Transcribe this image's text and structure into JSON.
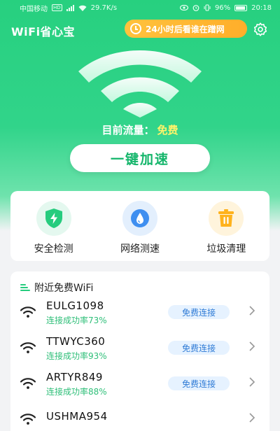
{
  "status_bar": {
    "carrier": "中国移动",
    "network_type": "HD",
    "speed": "29.7K/s",
    "battery": "96%",
    "time": "20:18"
  },
  "header": {
    "app_title": "WiFi省心宝",
    "promo_label": "24小时后看谁在蹭网"
  },
  "hero": {
    "traffic_label": "目前流量：",
    "traffic_value": "免费",
    "speed_button": "一键加速"
  },
  "tools": [
    {
      "label": "安全检测",
      "icon": "shield-bolt-icon",
      "bg": "#e4f8ef",
      "color": "#26cc7e"
    },
    {
      "label": "网络测速",
      "icon": "speed-drop-icon",
      "bg": "#e3effd",
      "color": "#3f8ff0"
    },
    {
      "label": "垃圾清理",
      "icon": "trash-icon",
      "bg": "#fff4dc",
      "color": "#ffb21c"
    }
  ],
  "nearby": {
    "title": "附近免费WiFi",
    "items": [
      {
        "ssid": "EULG1098",
        "rate": "连接成功率73%",
        "action": "免费连接"
      },
      {
        "ssid": "TTWYC360",
        "rate": "连接成功率93%",
        "action": "免费连接"
      },
      {
        "ssid": "ARTYR849",
        "rate": "连接成功率88%",
        "action": "免费连接"
      },
      {
        "ssid": "USHMA954",
        "rate": "",
        "action": ""
      }
    ]
  },
  "colors": {
    "brand_green": "#27d07f",
    "promo_orange": "#ffb22a",
    "free_yellow": "#fff36a",
    "link_blue": "#2f7bd6"
  }
}
